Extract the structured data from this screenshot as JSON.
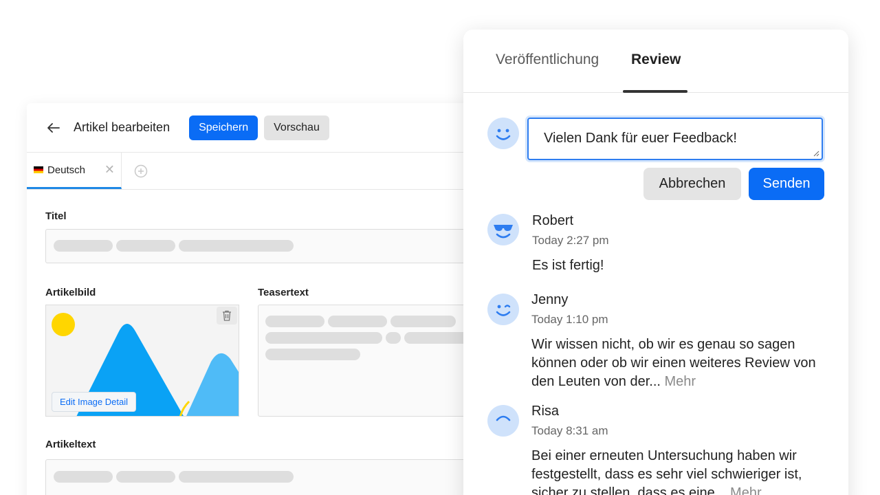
{
  "editor": {
    "title": "Artikel bearbeiten",
    "save_label": "Speichern",
    "preview_label": "Vorschau",
    "language_tab": "Deutsch",
    "labels": {
      "title": "Titel",
      "image": "Artikelbild",
      "teaser": "Teasertext",
      "body": "Artikeltext"
    },
    "edit_image_label": "Edit Image Detail"
  },
  "panel": {
    "tabs": [
      "Veröffentlichung",
      "Review"
    ],
    "active_tab": "Review",
    "comment_input_value": "Vielen Dank für euer Feedback!",
    "cancel_label": "Abbrechen",
    "send_label": "Senden",
    "more_label": "Mehr",
    "comments": [
      {
        "name": "Robert",
        "time": "Today 2:27 pm",
        "body": "Es ist fertig!",
        "avatar": "cool-face-icon"
      },
      {
        "name": "Jenny",
        "time": "Today 1:10 pm",
        "body": "Wir wissen nicht, ob wir es genau so sagen können oder ob wir einen weiteres Review von den Leuten von der...",
        "avatar": "wink-face-icon"
      },
      {
        "name": "Risa",
        "time": "Today 8:31 am",
        "body": "Bei einer erneuten Untersuchung haben wir festgestellt, dass es sehr viel schwieriger ist, sicher zu stellen, dass es eine...",
        "avatar": "frown-face-icon"
      }
    ]
  },
  "colors": {
    "accent": "#0a6cf5",
    "avatar_bg": "#cfe2fb",
    "avatar_face": "#2e7df0"
  }
}
